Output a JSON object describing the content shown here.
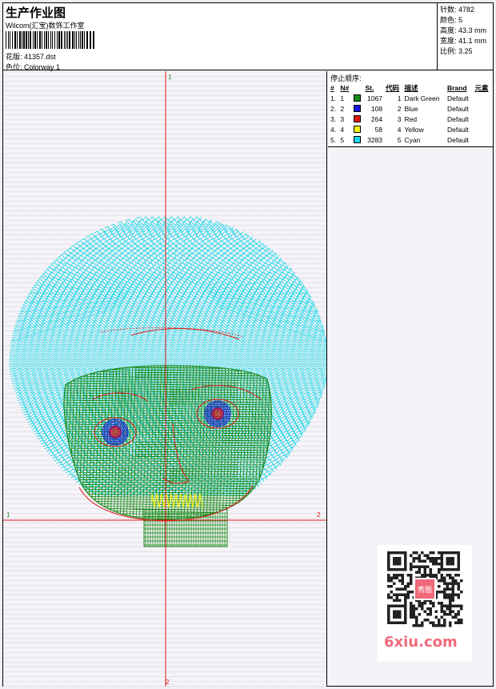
{
  "header": {
    "title": "生产作业图",
    "company": "Wilcom(汇宝)数饰工作室",
    "design_label": "花版:",
    "design_name": "41357.dst",
    "colorway_label": "色位:",
    "colorway_name": "Colorway 1"
  },
  "stats": [
    {
      "label": "针数:",
      "value": "4782"
    },
    {
      "label": "颜色:",
      "value": "5"
    },
    {
      "label": "高度:",
      "value": "43.3 mm"
    },
    {
      "label": "宽度:",
      "value": "41.1 mm"
    },
    {
      "label": "比例:",
      "value": "3.25"
    }
  ],
  "stop_sequence": {
    "title": "停止顺序:",
    "columns": [
      "#",
      "N#",
      "St.",
      "代码",
      "描述",
      "Brand",
      "元素"
    ],
    "rows": [
      {
        "idx": "1.",
        "n": "1",
        "color": "#1a8a1a",
        "st": "1067",
        "code": "1",
        "desc": "Dark Green",
        "brand": "Default"
      },
      {
        "idx": "2.",
        "n": "2",
        "color": "#1818e0",
        "st": "108",
        "code": "2",
        "desc": "Blue",
        "brand": "Default"
      },
      {
        "idx": "3.",
        "n": "3",
        "color": "#e01818",
        "st": "264",
        "code": "3",
        "desc": "Red",
        "brand": "Default"
      },
      {
        "idx": "4.",
        "n": "4",
        "color": "#f0f018",
        "st": "58",
        "code": "4",
        "desc": "Yellow",
        "brand": "Default"
      },
      {
        "idx": "5.",
        "n": "5",
        "color": "#18d8e8",
        "st": "3283",
        "code": "5",
        "desc": "Cyan",
        "brand": "Default"
      }
    ]
  },
  "axes": {
    "top_label": "1",
    "bottom_label": "2",
    "left_label": "1",
    "right_label": "2",
    "axis_color": "#e01818"
  },
  "watermark": {
    "text": "6xiu.com",
    "color": "#f06a7a",
    "qr_center_text": "秀图"
  }
}
